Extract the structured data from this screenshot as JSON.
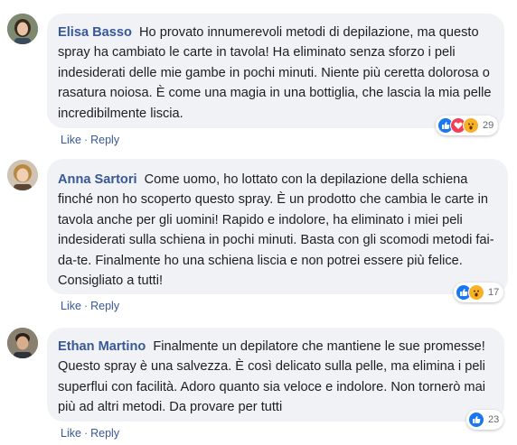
{
  "comments": [
    {
      "author": "Elisa Basso",
      "text": "Ho provato innumerevoli metodi di depilazione, ma questo spray ha cambiato le carte in tavola! Ha eliminato senza sforzo i peli indesiderati delle mie gambe in pochi minuti. Niente più ceretta dolorosa o rasatura noiosa. È come una magia in una bottiglia, che lascia la mia pelle incredibilmente liscia.",
      "reaction_icons": [
        "like-icon",
        "love-icon",
        "wow-icon"
      ],
      "reaction_count": "29",
      "like_label": "Like",
      "reply_label": "Reply"
    },
    {
      "author": "Anna Sartori",
      "text": "Come uomo, ho lottato con la depilazione della schiena finché non ho scoperto questo spray. È un prodotto che cambia le carte in tavola anche per gli uomini! Rapido e indolore, ha eliminato i miei peli indesiderati sulla schiena in pochi minuti. Basta con gli scomodi metodi fai-da-te. Finalmente ho una schiena liscia e non potrei essere più felice. Consigliato a tutti!",
      "reaction_icons": [
        "like-icon",
        "wow-icon"
      ],
      "reaction_count": "17",
      "like_label": "Like",
      "reply_label": "Reply"
    },
    {
      "author": "Ethan Martino",
      "text": "Finalmente un depilatore che mantiene le sue promesse! Questo spray è una salvezza. È così delicato sulla pelle, ma elimina i peli superflui con facilità. Adoro quanto sia veloce e indolore. Non tornerò mai più ad altri metodi. Da provare per tutti",
      "reaction_icons": [
        "like-icon"
      ],
      "reaction_count": "23",
      "like_label": "Like",
      "reply_label": "Reply"
    }
  ],
  "separator": "·",
  "colors": {
    "author": "#385898",
    "bubble": "#f0f2f5",
    "like": "#1877f2",
    "love": "#f33e58",
    "wow": "#f7b125"
  }
}
